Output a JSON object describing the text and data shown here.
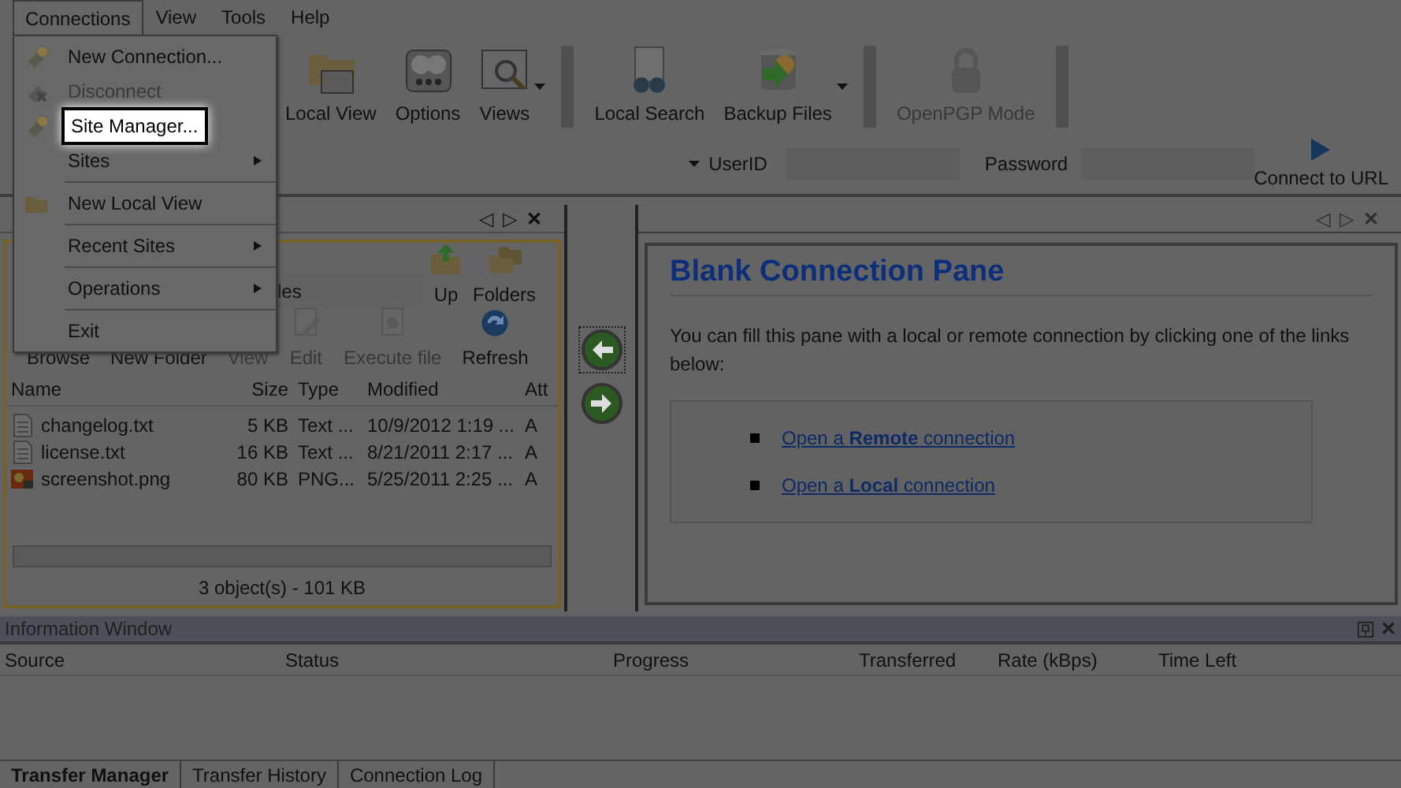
{
  "menu_bar": [
    {
      "label": "Connections",
      "selected": true
    },
    {
      "label": "View",
      "selected": false
    },
    {
      "label": "Tools",
      "selected": false
    },
    {
      "label": "Help",
      "selected": false
    }
  ],
  "connections_menu": [
    {
      "kind": "item",
      "label": "New Connection...",
      "disabled": false,
      "highlighted": false,
      "submenu": false
    },
    {
      "kind": "item",
      "label": "Disconnect",
      "disabled": true,
      "highlighted": false,
      "submenu": false
    },
    {
      "kind": "item",
      "label": "Site Manager...",
      "disabled": false,
      "highlighted": true,
      "submenu": false
    },
    {
      "kind": "item",
      "label": "Sites",
      "disabled": false,
      "highlighted": false,
      "submenu": true
    },
    {
      "kind": "separator"
    },
    {
      "kind": "item",
      "label": "New Local View",
      "disabled": false,
      "highlighted": false,
      "submenu": false
    },
    {
      "kind": "separator"
    },
    {
      "kind": "item",
      "label": "Recent Sites",
      "disabled": false,
      "highlighted": false,
      "submenu": true
    },
    {
      "kind": "separator"
    },
    {
      "kind": "item",
      "label": "Operations",
      "disabled": false,
      "highlighted": false,
      "submenu": true
    },
    {
      "kind": "separator"
    },
    {
      "kind": "item",
      "label": "Exit",
      "disabled": false,
      "highlighted": false,
      "submenu": false
    }
  ],
  "toolbar": [
    {
      "label": "Local View",
      "disabled": false,
      "dropdown": false
    },
    {
      "label": "Options",
      "disabled": false,
      "dropdown": false
    },
    {
      "label": "Views",
      "disabled": false,
      "dropdown": true
    },
    {
      "label": "Local Search",
      "disabled": false,
      "dropdown": false
    },
    {
      "label": "Backup Files",
      "disabled": false,
      "dropdown": true
    },
    {
      "label": "OpenPGP Mode",
      "disabled": true,
      "dropdown": false
    }
  ],
  "quick_connect": {
    "userid_label": "UserID",
    "password_label": "Password",
    "connect_button": "Connect to URL"
  },
  "local_pane": {
    "tab_controls": [
      "◁",
      "▷",
      "✕"
    ],
    "path_value": "les",
    "toolbar_top": [
      {
        "label": "Up",
        "disabled": false
      },
      {
        "label": "Folders",
        "disabled": false
      }
    ],
    "toolbar_bottom": [
      {
        "label": "Browse",
        "disabled": false
      },
      {
        "label": "New Folder",
        "disabled": false
      },
      {
        "label": "View",
        "disabled": true
      },
      {
        "label": "Edit",
        "disabled": true
      },
      {
        "label": "Execute file",
        "disabled": true
      },
      {
        "label": "Refresh",
        "disabled": false
      }
    ],
    "columns": [
      "Name",
      "Size",
      "Type",
      "Modified",
      "Att"
    ],
    "rows": [
      {
        "kind": "text",
        "name": "changelog.txt",
        "size": "5 KB",
        "type": "Text ...",
        "modified": "10/9/2012 1:19 ...",
        "att": "A"
      },
      {
        "kind": "text",
        "name": "license.txt",
        "size": "16 KB",
        "type": "Text ...",
        "modified": "8/21/2011 2:17 ...",
        "att": "A"
      },
      {
        "kind": "image",
        "name": "screenshot.png",
        "size": "80 KB",
        "type": "PNG...",
        "modified": "5/25/2011 2:25 ...",
        "att": "A"
      }
    ],
    "status": "3 object(s) - 101 KB"
  },
  "connection_pane": {
    "tab_controls": [
      "◁",
      "▷",
      "✕"
    ],
    "title": "Blank Connection Pane",
    "text": "You can fill this pane with a local or remote connection by clicking one of the links below:",
    "links": [
      "Open a **Remote** connection",
      "Open a **Local** connection"
    ]
  },
  "information_window": {
    "title": "Information Window",
    "close": "✕",
    "columns": [
      "Source",
      "Status",
      "Progress",
      "Transferred",
      "Rate (kBps)",
      "Time Left"
    ],
    "tabs": [
      {
        "label": "Transfer Manager",
        "selected": true
      },
      {
        "label": "Transfer History",
        "selected": false
      },
      {
        "label": "Connection Log",
        "selected": false
      }
    ]
  }
}
